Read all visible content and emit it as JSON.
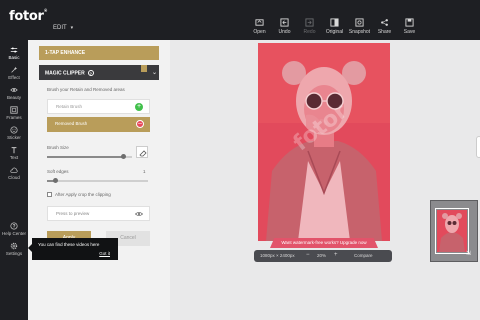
{
  "app": {
    "logo": "fotor",
    "logo_mark": "®",
    "menu": "EDIT"
  },
  "toolbar": [
    {
      "label": "Open",
      "icon": "open-icon",
      "enabled": true
    },
    {
      "label": "Undo",
      "icon": "undo-icon",
      "enabled": true
    },
    {
      "label": "Redo",
      "icon": "redo-icon",
      "enabled": false
    },
    {
      "label": "Original",
      "icon": "original-icon",
      "enabled": true
    },
    {
      "label": "Snapshot",
      "icon": "snapshot-icon",
      "enabled": true
    },
    {
      "label": "Share",
      "icon": "share-icon",
      "enabled": true
    },
    {
      "label": "Save",
      "icon": "save-icon",
      "enabled": true
    }
  ],
  "rail": [
    {
      "label": "Basic",
      "icon": "sliders-icon",
      "active": true
    },
    {
      "label": "Effect",
      "icon": "effect-icon"
    },
    {
      "label": "Beauty",
      "icon": "eye-icon"
    },
    {
      "label": "Frames",
      "icon": "frame-icon"
    },
    {
      "label": "Sticker",
      "icon": "sticker-icon"
    },
    {
      "label": "Text",
      "icon": "text-icon"
    },
    {
      "label": "Cloud",
      "icon": "cloud-icon"
    },
    {
      "label": "Help Center",
      "icon": "help-icon"
    },
    {
      "label": "Settings",
      "icon": "settings-icon"
    }
  ],
  "panel": {
    "enhance_label": "1-TAP ENHANCE",
    "magic_label": "MAGIC CLIPPER",
    "help_glyph": "?",
    "hint": "Brush your Retain and Removed areas",
    "retain_label": "Retain Brush",
    "remove_label": "Removed Brush",
    "brush_size_label": "Brush Size",
    "brush_size_level": 0.9,
    "soft_edges_label": "Soft edges",
    "soft_edges_value": "1",
    "soft_edges_level": 0.08,
    "crop_label": "After Apply crop the clipping",
    "crop_checked": false,
    "preview_label": "Press to preview",
    "apply_label": "Apply",
    "cancel_label": "Cancel"
  },
  "tooltip": {
    "text": "You can find these videos here",
    "action": "Got it"
  },
  "canvas": {
    "watermark": "fotor",
    "banner": "Want watermark-free works? Upgrade now",
    "dimensions": "1080px × 2400px",
    "zoom": "20%",
    "compare_label": "Compare",
    "minus": "−",
    "plus": "+"
  },
  "colors": {
    "accent": "#b99d5a",
    "dark": "#1e1f23",
    "overlay": "#d9485a",
    "add": "#41c04b",
    "remove": "#e84b5c"
  }
}
